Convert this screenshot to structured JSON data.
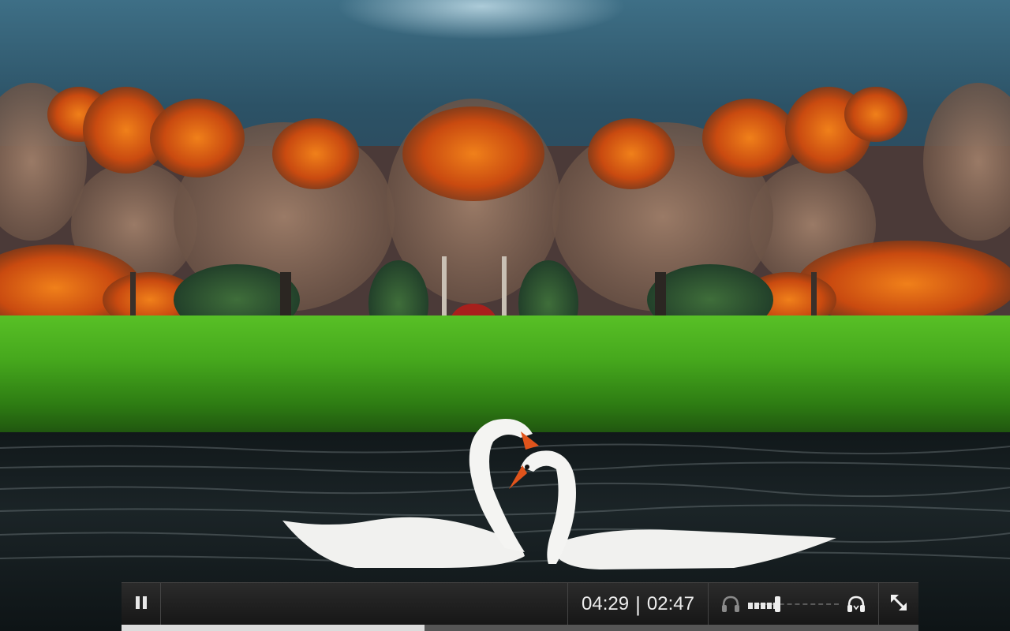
{
  "player": {
    "current_time": "04:29",
    "separator": "|",
    "duration": "02:47",
    "playback_progress_fraction": 0.38,
    "volume_fraction": 0.32,
    "state": "playing",
    "icons": {
      "pause": "pause-icon",
      "volume_low": "headphones-mute-icon",
      "volume_high": "headphones-icon",
      "fullscreen": "fullscreen-icon"
    }
  },
  "colors": {
    "bar_background": "#1e1e1e",
    "icon_color": "#e8e8e8",
    "progress_fill": "#dcdcdc"
  }
}
